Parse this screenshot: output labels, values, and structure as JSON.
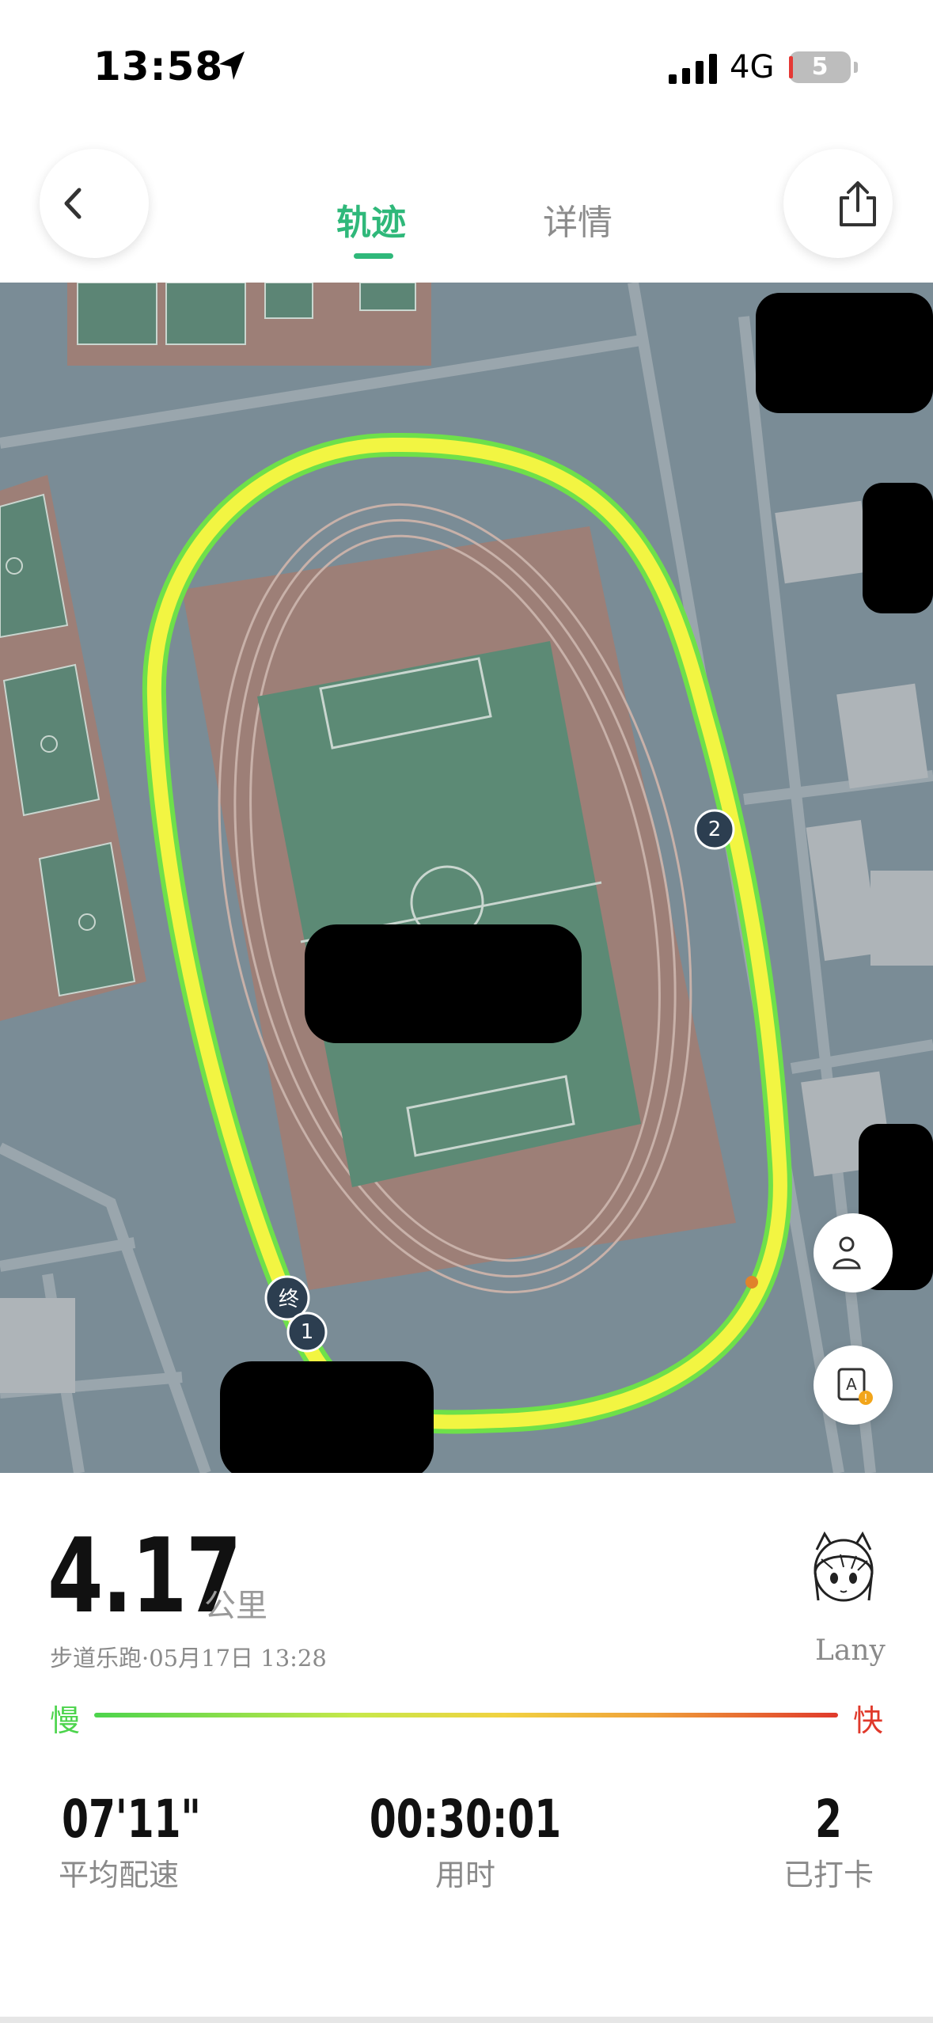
{
  "status_bar": {
    "time": "13:58",
    "network": "4G",
    "battery": "5"
  },
  "nav": {
    "tabs": [
      {
        "label": "轨迹",
        "active": true
      },
      {
        "label": "详情",
        "active": false
      }
    ]
  },
  "icons": {
    "back": "chevron-left-icon",
    "share": "share-icon",
    "location": "person-location-icon",
    "map_layer": "map-layer-icon",
    "navigate": "location-arrow-icon"
  },
  "map": {
    "markers": [
      {
        "label": "终"
      },
      {
        "label": "1"
      },
      {
        "label": "2"
      }
    ]
  },
  "run": {
    "distance": "4.17",
    "distance_unit": "公里",
    "info": "步道乐跑·05月17日 13:28",
    "username": "Lany"
  },
  "pace_legend": {
    "slow": "慢",
    "fast": "快"
  },
  "stats": [
    {
      "value": "07'11\"",
      "label": "平均配速"
    },
    {
      "value": "00:30:01",
      "label": "用时"
    },
    {
      "value": "2",
      "label": "已打卡"
    }
  ],
  "colors": {
    "accent": "#2fb87a",
    "track": "#f2f542",
    "slow": "#4cd44c",
    "fast": "#e0392b",
    "map_bg": "#7a8c96"
  }
}
